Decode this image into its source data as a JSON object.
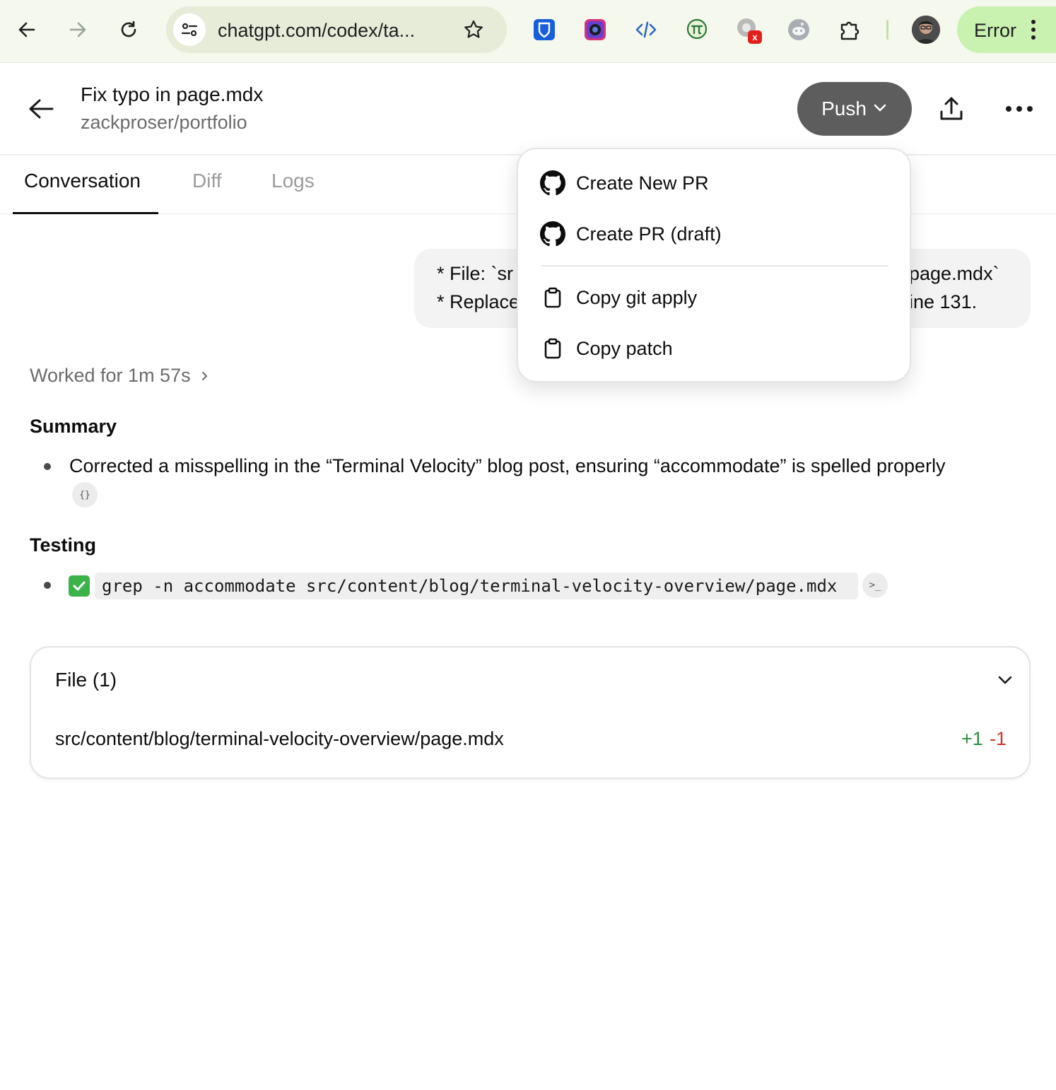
{
  "browser": {
    "url": "chatgpt.com/codex/ta...",
    "profile_status": "Error",
    "extensions": [
      "bitwarden-icon",
      "camera-extension-icon",
      "code-inspector-icon",
      "pi-extension-icon",
      "blocked-extension-icon",
      "reddit-icon",
      "puzzle-extensions-icon"
    ],
    "blocked_badge": "x"
  },
  "header": {
    "title": "Fix typo in page.mdx",
    "repo": "zackproser/portfolio",
    "push_label": "Push"
  },
  "tabs": [
    {
      "label": "Conversation",
      "active": true
    },
    {
      "label": "Diff",
      "active": false
    },
    {
      "label": "Logs",
      "active": false
    }
  ],
  "prompt_bubble": {
    "line1_left": "* File: `sr",
    "line1_right": "page.mdx`",
    "line2_left": "* Replace",
    "line2_right": "ine 131."
  },
  "worked": {
    "label": "Worked for 1m 57s"
  },
  "summary": {
    "heading": "Summary",
    "items": [
      "Corrected a misspelling in the “Terminal Velocity” blog post, ensuring “accommodate” is spelled properly"
    ],
    "citation_chip": "{}"
  },
  "testing": {
    "heading": "Testing",
    "command": "grep -n accommodate src/content/blog/terminal-velocity-overview/page.mdx",
    "terminal_chip": ">_"
  },
  "files": {
    "title": "File (1)",
    "items": [
      {
        "path": "src/content/blog/terminal-velocity-overview/page.mdx",
        "additions": "+1",
        "deletions": "-1"
      }
    ]
  },
  "push_menu": {
    "items": [
      {
        "label": "Create New PR",
        "icon": "github-icon"
      },
      {
        "label": "Create PR (draft)",
        "icon": "github-icon"
      },
      {
        "label": "Copy git apply",
        "icon": "clipboard-icon"
      },
      {
        "label": "Copy patch",
        "icon": "clipboard-icon"
      }
    ]
  },
  "colors": {
    "chrome_bg": "#f5f8ec",
    "error_pill": "#c9f1b0",
    "push_button": "#5d5d5d",
    "additions": "#2e8b3e",
    "deletions": "#d0342c"
  }
}
